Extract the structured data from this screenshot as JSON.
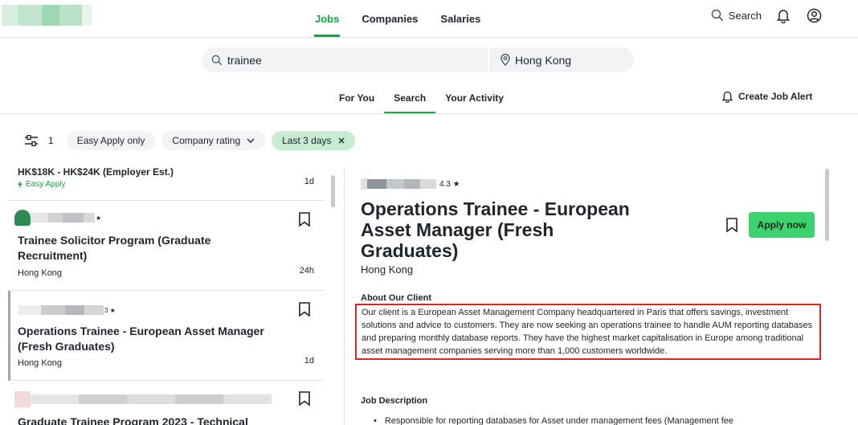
{
  "header": {
    "nav": [
      {
        "label": "Jobs",
        "active": true
      },
      {
        "label": "Companies",
        "active": false
      },
      {
        "label": "Salaries",
        "active": false
      }
    ],
    "search_label": "Search"
  },
  "searchbar": {
    "keyword": "trainee",
    "location": "Hong Kong"
  },
  "subtabs": [
    {
      "label": "For You",
      "active": false
    },
    {
      "label": "Search",
      "active": true
    },
    {
      "label": "Your Activity",
      "active": false
    }
  ],
  "create_alert_label": "Create Job Alert",
  "filters": {
    "count": "1",
    "chips": [
      {
        "label": "Easy Apply only"
      },
      {
        "label": "Company rating",
        "dropdown": true
      },
      {
        "label": "Last 3 days",
        "active": true
      }
    ]
  },
  "jobs": [
    {
      "salary": "HK$18K - HK$24K (Employer Est.)",
      "easy_apply": "Easy Apply",
      "age": "1d"
    },
    {
      "rating": "★",
      "title_line1": "Trainee Solicitor Program (Graduate",
      "title_line2": "Recruitment)",
      "location": "Hong Kong",
      "age": "24h"
    },
    {
      "rating": "3 ★",
      "title_line1": "Operations Trainee - European Asset Manager",
      "title_line2": "(Fresh Graduates)",
      "location": "Hong Kong",
      "age": "1d"
    },
    {
      "title_line1": "Graduate Trainee Program 2023 - Technical"
    }
  ],
  "detail": {
    "rating": "4.3 ★",
    "title": "Operations Trainee - European Asset Manager (Fresh Graduates)",
    "location": "Hong Kong",
    "apply_label": "Apply now",
    "about_heading": "About Our Client",
    "about_text": "Our client is a European Asset Management Company headquartered in Paris that offers savings, investment solutions and advice to customers. They are now seeking an operations trainee to handle AUM reporting databases and preparing monthly database reports. They have the highest market capitalisation in Europe among traditional asset management companies serving more than 1,000 customers worldwide.",
    "desc_heading": "Job Description",
    "desc_bullet": "Responsible for reporting databases for Asset under management fees (Management fee"
  },
  "colors": {
    "accent": "#0caa41",
    "apply_button": "#3cd36f",
    "active_chip": "#c6ecd1",
    "highlight_border": "#e02424"
  }
}
